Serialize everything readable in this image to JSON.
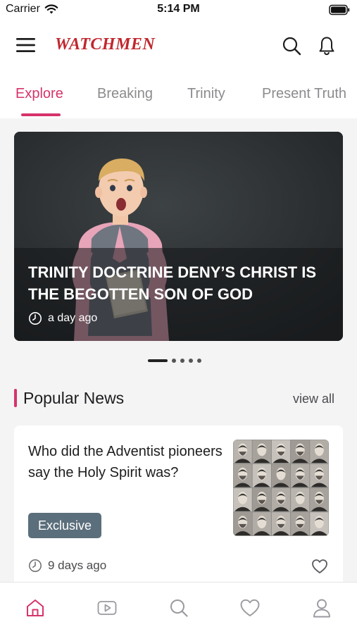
{
  "status_bar": {
    "carrier": "Carrier",
    "time": "5:14 PM",
    "icons": [
      "wifi-icon",
      "battery-icon"
    ]
  },
  "app_bar": {
    "brand": "WATCHMEN",
    "brand_color": "#c0272d",
    "icons": [
      "menu-icon",
      "search-icon",
      "bell-icon"
    ]
  },
  "tabs": [
    {
      "label": "Explore",
      "active": true
    },
    {
      "label": "Breaking",
      "active": false
    },
    {
      "label": "Trinity",
      "active": false
    },
    {
      "label": "Present Truth",
      "active": false
    }
  ],
  "accent_color": "#d6336c",
  "hero": {
    "title": "TRINITY DOCTRINE DENY’S CHRIST IS THE BEGOTTEN SON OF GOD",
    "time": "a day ago",
    "image": "surprised child holding a book"
  },
  "carousel": {
    "total_pages": 5,
    "current_page": 1
  },
  "popular_news": {
    "heading": "Popular News",
    "view_all": "view all",
    "items": [
      {
        "title": "Who did the Adventist pioneers say the Holy Spirit was?",
        "badge": "Exclusive",
        "badge_color": "#5b6e7b",
        "time": "9 days ago",
        "image": "grid of historical portrait photographs"
      }
    ]
  },
  "bottom_nav": [
    {
      "icon": "home-icon",
      "active": true
    },
    {
      "icon": "video-icon",
      "active": false
    },
    {
      "icon": "search-icon",
      "active": false
    },
    {
      "icon": "heart-icon",
      "active": false
    },
    {
      "icon": "profile-icon",
      "active": false
    }
  ]
}
